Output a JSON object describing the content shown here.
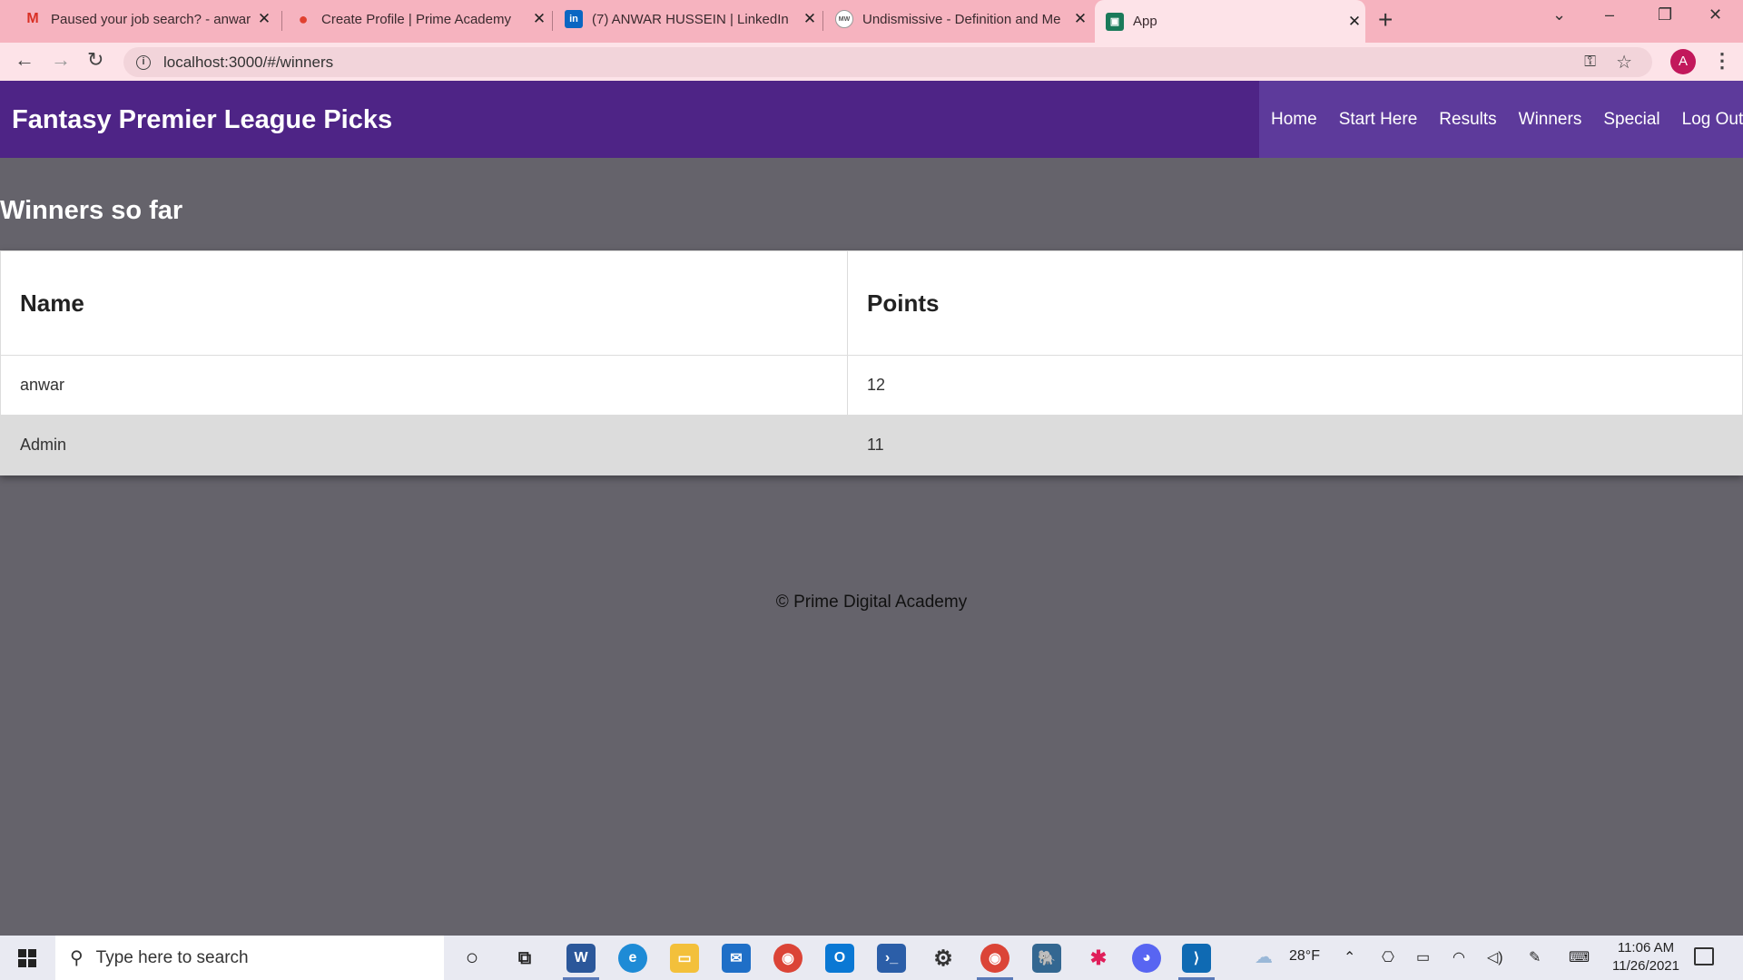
{
  "browser": {
    "tabs": [
      {
        "title": "Paused your job search? - anwar",
        "icon": "gmail-icon",
        "color": "#d93025",
        "glyph": "M"
      },
      {
        "title": "Create Profile | Prime Academy",
        "icon": "prime-academy-icon",
        "color": "#e0402f",
        "glyph": "●"
      },
      {
        "title": "(7) ANWAR HUSSEIN | LinkedIn",
        "icon": "linkedin-icon",
        "color": "#0a66c2",
        "glyph": "in"
      },
      {
        "title": "Undismissive - Definition and Me",
        "icon": "merriam-webster-icon",
        "color": "#ffffff",
        "glyph": "MW"
      },
      {
        "title": "App",
        "icon": "app-icon",
        "color": "#1a7a5a",
        "glyph": "▣"
      }
    ],
    "url": "localhost:3000/#/winners",
    "profile_initial": "A"
  },
  "app": {
    "title": "Fantasy Premier League Picks",
    "nav": [
      "Home",
      "Start Here",
      "Results",
      "Winners",
      "Special",
      "Log Out"
    ],
    "heading": "Winners so far",
    "table": {
      "headers": [
        "Name",
        "Points"
      ],
      "rows": [
        [
          "anwar",
          "12"
        ],
        [
          "Admin",
          "11"
        ]
      ]
    },
    "footer": "© Prime Digital Academy"
  },
  "colors": {
    "header": "#4e2486",
    "nav_bg": "#5d3a9b",
    "page_bg": "#65636b"
  },
  "taskbar": {
    "search_placeholder": "Type here to search",
    "weather": "28°F",
    "time": "11:06 AM",
    "date": "11/26/2021"
  }
}
